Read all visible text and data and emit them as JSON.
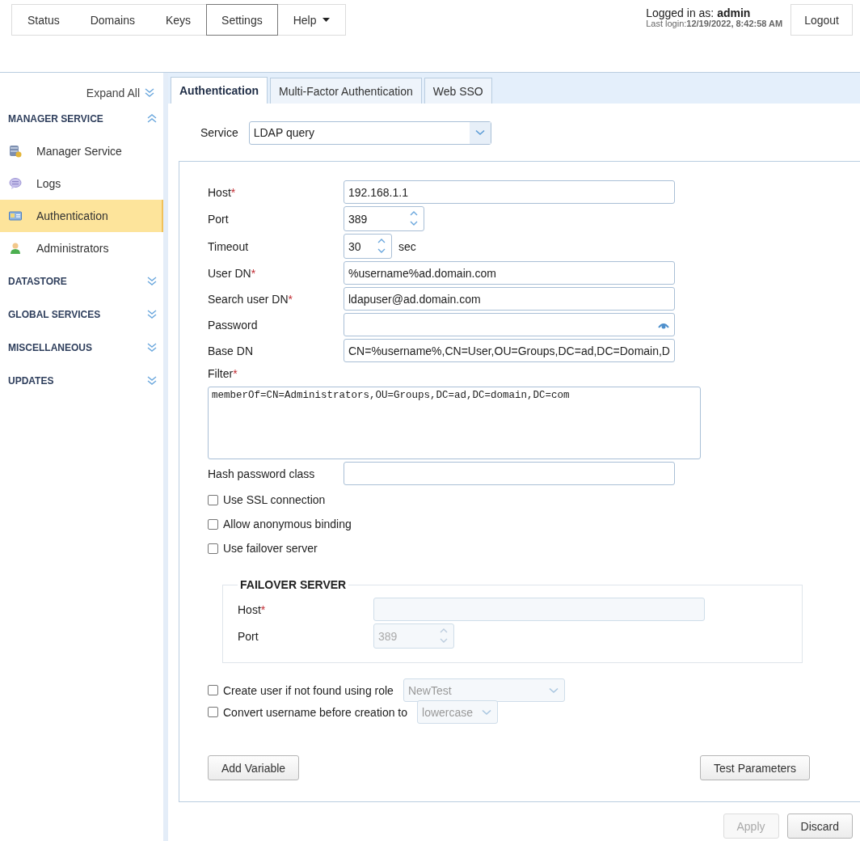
{
  "nav": {
    "items": [
      {
        "label": "Status",
        "selected": false
      },
      {
        "label": "Domains",
        "selected": false
      },
      {
        "label": "Keys",
        "selected": false
      },
      {
        "label": "Settings",
        "selected": true
      },
      {
        "label": "Help",
        "selected": false,
        "kind": "dropdown"
      }
    ]
  },
  "login": {
    "user_line": "Logged in as: **admin**",
    "last_login": "Last login:**12/19/2022, 8:42:58 AM**"
  },
  "logout_button": "Logout",
  "sidebar": {
    "expand_all": "Expand All",
    "sections": [
      {
        "title": "MANAGER SERVICE",
        "expanded": true,
        "items": [
          {
            "label": "Manager Service",
            "kind": "database",
            "selected": false
          },
          {
            "label": "Logs",
            "kind": "chat",
            "selected": false
          },
          {
            "label": "Authentication",
            "kind": "card",
            "selected": true
          },
          {
            "label": "Administrators",
            "kind": "user",
            "selected": false
          }
        ]
      },
      {
        "title": "DATASTORE",
        "expanded": false
      },
      {
        "title": "GLOBAL SERVICES",
        "expanded": false
      },
      {
        "title": "MISCELLANEOUS",
        "expanded": false
      },
      {
        "title": "UPDATES",
        "expanded": false
      }
    ]
  },
  "tabs": [
    {
      "label": "Authentication",
      "selected": true
    },
    {
      "label": "Multi-Factor Authentication",
      "selected": false
    },
    {
      "label": "Web SSO",
      "selected": false
    }
  ],
  "service": {
    "label": "Service",
    "value": "LDAP query"
  },
  "fields": [
    {
      "kind": "text",
      "label": "Host",
      "required_mark": "*",
      "value": "192.168.1.1"
    },
    {
      "kind": "number",
      "label": "Port",
      "value": "389"
    },
    {
      "kind": "number",
      "label": "Timeout",
      "value": "30",
      "unit": "sec"
    },
    {
      "kind": "text",
      "label": "User DN",
      "required_mark": "*",
      "value": "%username%ad.domain.com"
    },
    {
      "kind": "text",
      "label": "Search user DN",
      "required_mark": "*",
      "value": "ldapuser@ad.domain.com"
    },
    {
      "kind": "password",
      "label": "Password"
    },
    {
      "kind": "text",
      "label": "Base DN",
      "value": "CN=%username%,CN=User,OU=Groups,DC=ad,DC=Domain,D"
    },
    {
      "kind": "textarea",
      "label": "Filter",
      "required_mark": "*",
      "value": "memberOf=CN=Administrators,OU=Groups,DC=ad,DC=domain,DC=com"
    },
    {
      "kind": "text",
      "label": "Hash password class"
    }
  ],
  "checkboxes": [
    {
      "label": "Use SSL connection",
      "checked": false
    },
    {
      "label": "Allow anonymous binding",
      "checked": false
    },
    {
      "label": "Use failover server",
      "checked": false
    }
  ],
  "failover": {
    "title": "FAILOVER SERVER",
    "disabled": true,
    "fields": [
      {
        "kind": "text",
        "label": "Host",
        "required_mark": "*"
      },
      {
        "kind": "number",
        "label": "Port",
        "value": "389"
      }
    ]
  },
  "role_options": [
    {
      "label": "Create user if not found using role",
      "checked": false,
      "value": "NewTest",
      "disabled": true
    },
    {
      "label": "Convert username before creation to",
      "checked": false,
      "value": "lowercase",
      "disabled": true
    }
  ],
  "add_variable_button": "Add Variable",
  "test_parameters_button": "Test Parameters",
  "footer_buttons": [
    {
      "label": "Apply",
      "disabled": true
    },
    {
      "label": "Discard",
      "disabled": false
    }
  ]
}
